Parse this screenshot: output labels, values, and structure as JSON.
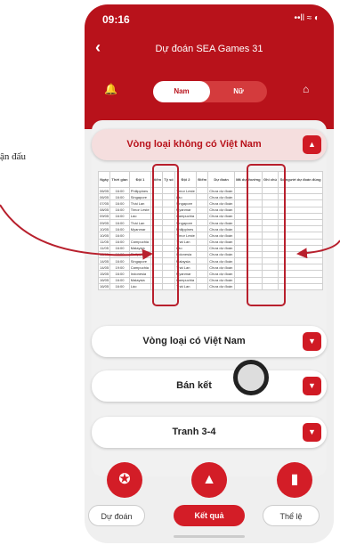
{
  "annotation": "ận đấu",
  "status": {
    "time": "09:16",
    "right": "••ll ≈ ◐"
  },
  "header": {
    "back": "‹",
    "title": "Dự đoán SEA Games 31",
    "tab_nam": "Nam",
    "tab_nu": "Nữ"
  },
  "groups": [
    {
      "label": "Vòng loại không có Việt Nam",
      "chevron": "▲"
    },
    {
      "label": "Vòng loại có Việt Nam",
      "chevron": "▼"
    },
    {
      "label": "Bán kết",
      "chevron": "▼"
    },
    {
      "label": "Tranh 3-4",
      "chevron": "▼"
    }
  ],
  "table": {
    "headers": [
      "Ngày",
      "Thời gian",
      "Đội 1",
      "Điểm",
      "Tỷ số",
      "Đội 2",
      "Điểm",
      "Dự đoán",
      "Mã dự thưởng",
      "Ghi chú",
      "Số người dự đoán đúng"
    ],
    "rows": [
      [
        "06/05",
        "16:00",
        "Philippines",
        "",
        "",
        "Timor Leste",
        "",
        "Chưa dự đoán",
        "",
        "",
        ""
      ],
      [
        "06/05",
        "16:00",
        "Singapore",
        "",
        "",
        "Lào",
        "",
        "Chưa dự đoán",
        "",
        "",
        ""
      ],
      [
        "07/05",
        "16:00",
        "Thái Lan",
        "",
        "",
        "Singapore",
        "",
        "Chưa dự đoán",
        "",
        "",
        ""
      ],
      [
        "08/05",
        "16:00",
        "Timor Leste",
        "",
        "",
        "Myanmar",
        "",
        "Chưa dự đoán",
        "",
        "",
        ""
      ],
      [
        "09/05",
        "16:00",
        "Lào",
        "",
        "",
        "Campuchia",
        "",
        "Chưa dự đoán",
        "",
        "",
        ""
      ],
      [
        "09/05",
        "16:00",
        "Thái Lan",
        "",
        "",
        "Singapore",
        "",
        "Chưa dự đoán",
        "",
        "",
        ""
      ],
      [
        "10/05",
        "16:00",
        "Myanmar",
        "",
        "",
        "Philippines",
        "",
        "Chưa dự đoán",
        "",
        "",
        ""
      ],
      [
        "10/05",
        "16:00",
        "",
        "",
        "",
        "Timor Leste",
        "",
        "Chưa dự đoán",
        "",
        "",
        ""
      ],
      [
        "11/05",
        "16:00",
        "Campuchia",
        "",
        "",
        "Thái Lan",
        "",
        "Chưa dự đoán",
        "",
        "",
        ""
      ],
      [
        "11/05",
        "16:00",
        "Malaysia",
        "",
        "",
        "Lào",
        "",
        "Chưa dự đoán",
        "",
        "",
        ""
      ],
      [
        "13/05",
        "16:00",
        "Philippines",
        "",
        "",
        "Indonesia",
        "",
        "Chưa dự đoán",
        "",
        "",
        ""
      ],
      [
        "14/05",
        "16:00",
        "Singapore",
        "",
        "",
        "Malaysia",
        "",
        "Chưa dự đoán",
        "",
        "",
        ""
      ],
      [
        "14/05",
        "19:00",
        "Campuchia",
        "",
        "",
        "Thái Lan",
        "",
        "Chưa dự đoán",
        "",
        "",
        ""
      ],
      [
        "15/05",
        "16:00",
        "Indonesia",
        "",
        "",
        "Myanmar",
        "",
        "Chưa dự đoán",
        "",
        "",
        ""
      ],
      [
        "16/05",
        "16:00",
        "Malaysia",
        "",
        "",
        "Campuchia",
        "",
        "Chưa dự đoán",
        "",
        "",
        ""
      ],
      [
        "16/05",
        "16:00",
        "Lào",
        "",
        "",
        "Thái Lan",
        "",
        "Chưa dự đoán",
        "",
        "",
        ""
      ]
    ]
  },
  "nav": {
    "du_doan": "Dự đoán",
    "ket_qua": "Kết quả",
    "the_le": "Thể lệ"
  },
  "colors": {
    "accent": "#b8121b"
  },
  "icons": {
    "medal": "medal-icon",
    "mountain": "mountain-icon",
    "book": "book-icon"
  }
}
